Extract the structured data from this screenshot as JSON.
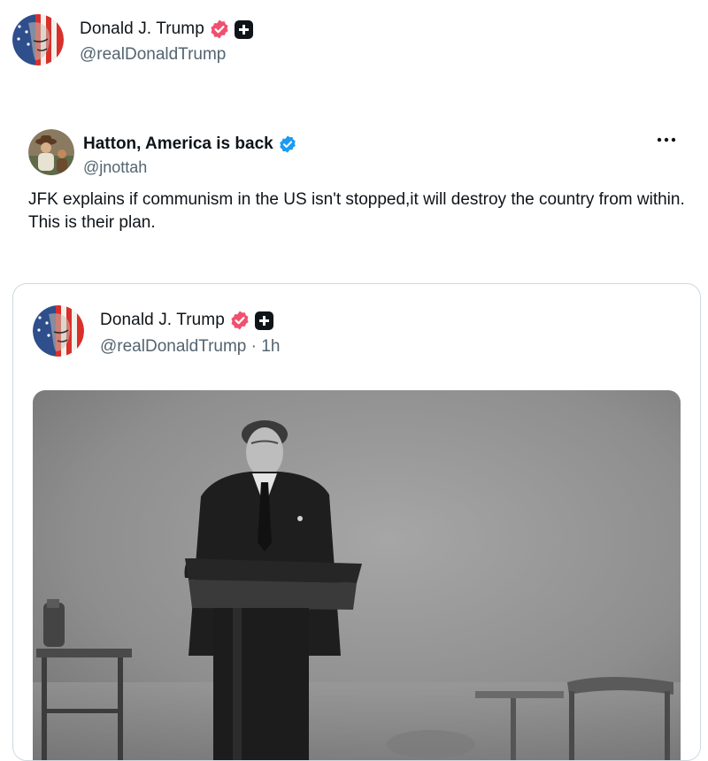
{
  "header": {
    "name": "Donald J. Trump",
    "handle": "@realDonaldTrump"
  },
  "post": {
    "author_name": "Hatton, America is back",
    "author_handle": "@jnottah",
    "text": "JFK explains if communism in the US isn't stopped,it will destroy the country from within.\nThis is their plan."
  },
  "quote": {
    "author_name": "Donald J. Trump",
    "author_handle": "@realDonaldTrump",
    "separator": "·",
    "time": "1h"
  },
  "icons": {
    "verified_gold": "verified-badge-icon",
    "verified_blue": "verified-badge-icon",
    "affiliate": "plus-square-icon",
    "more": "more-horizontal-icon"
  },
  "colors": {
    "badge_pink": "#f0506e",
    "badge_blue": "#1d9bf0",
    "secondary_text": "#536471",
    "card_border": "#cfd9de"
  }
}
